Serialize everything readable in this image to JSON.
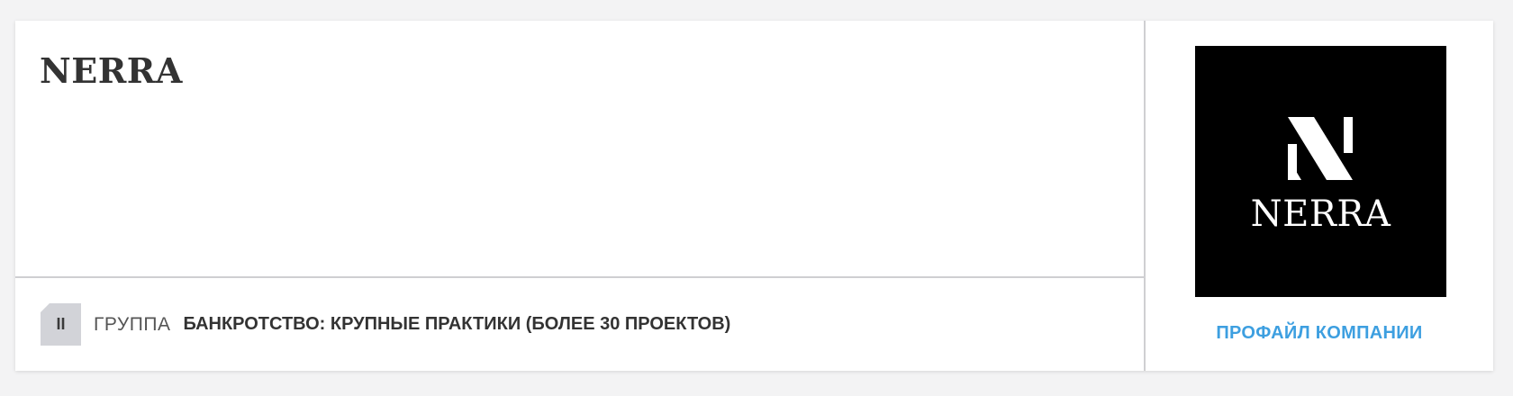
{
  "company": {
    "name": "NERRA"
  },
  "ranking": {
    "tier": "II",
    "group_label": "ГРУППА",
    "practice": "БАНКРОТСТВО: КРУПНЫЕ ПРАКТИКИ (БОЛЕЕ 30 ПРОЕКТОВ)"
  },
  "logo": {
    "text": "NERRA",
    "background": "#000000",
    "foreground": "#ffffff"
  },
  "profile_link": {
    "label": "ПРОФАЙЛ КОМПАНИИ",
    "color": "#3d9fe0"
  }
}
